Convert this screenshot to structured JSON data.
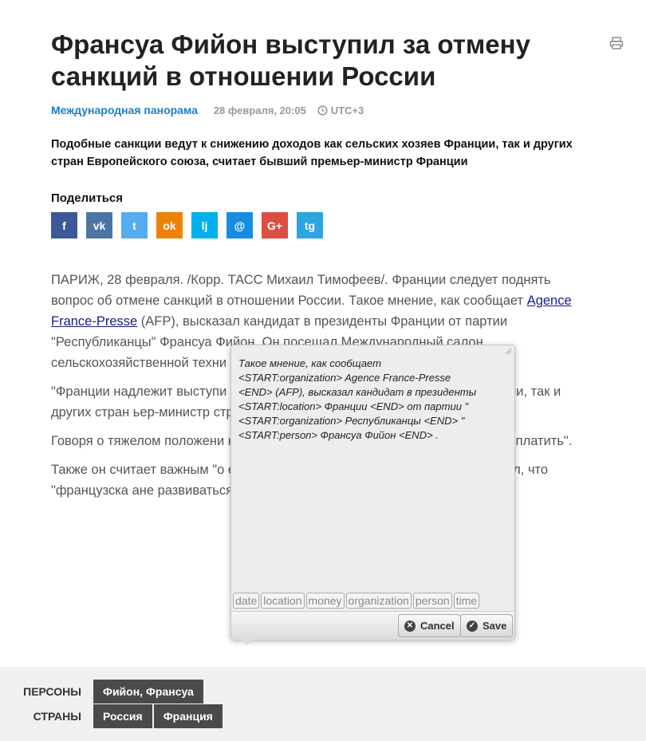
{
  "article": {
    "title": "Франсуа Фийон выступил за отмену санкций в отношении России",
    "rubric": "Международная панорама",
    "date": "28 февраля, 20:05",
    "timezone": "UTC+3",
    "lead": "Подобные санкции ведут к снижению доходов как сельских хозяев Франции, так и других стран Европейского союза, считает бывший премьер-министр Франции",
    "share_label": "Поделиться",
    "share_buttons": [
      {
        "name": "facebook",
        "glyph": "f",
        "color": "#3b5998"
      },
      {
        "name": "vkontakte",
        "glyph": "vk",
        "color": "#4c75a3"
      },
      {
        "name": "twitter",
        "glyph": "t",
        "color": "#55acee"
      },
      {
        "name": "odnoklassniki",
        "glyph": "ok",
        "color": "#ee8208"
      },
      {
        "name": "livejournal",
        "glyph": "lj",
        "color": "#00b0ea"
      },
      {
        "name": "mailru",
        "glyph": "@",
        "color": "#168de2"
      },
      {
        "name": "googleplus",
        "glyph": "G+",
        "color": "#dc4e41"
      },
      {
        "name": "telegram",
        "glyph": "tg",
        "color": "#2ca5e0"
      }
    ],
    "p1_a": "ПАРИЖ, 28 февраля. /Корр. ТАСС Михаил Тимофеев/. Франции следует поднять вопрос об отмене санкций в отношении России. Такое мнение, как сообщает ",
    "p1_link": "Agence France-Presse",
    "p1_b": " (AFP), высказал кандидат в президенты Франции от партии \"Республиканцы\" Франсуа Фийон. Он посещал Международный салон сельскохозяйственной техни",
    "p2": "\"Франции надлежит выступи                                                 нении России. Подобные санкции в                                                  ев Франции, так и других стран                                                  ьер-министр страны.",
    "p3": "Говоря о тяжелом положени                                                 н необходимость \"сократить н                                                     они вынуждены платить\".",
    "p4": "Также он считает важным \"о                                                еднее время добавлены к законода                                                 подчеркнул, что \"французска                                                   ане развиваться\"."
  },
  "popup": {
    "text_lines": [
      "Такое мнение, как сообщает",
      "<START:organization> Agence France-Presse",
      "<END>  (AFP), высказал кандидат в президенты",
      "<START:location> Франции <END>  от партии \"",
      "<START:organization> Республиканцы <END> \"",
      "<START:person> Франсуа Фийон <END> ."
    ],
    "tags": [
      "date",
      "location",
      "money",
      "organization",
      "person",
      "time"
    ],
    "cancel_label": "Cancel",
    "save_label": "Save"
  },
  "footer": {
    "persons_label": "ПЕРСОНЫ",
    "persons": [
      "Фийон, Франсуа"
    ],
    "countries_label": "СТРАНЫ",
    "countries": [
      "Россия",
      "Франция"
    ]
  }
}
